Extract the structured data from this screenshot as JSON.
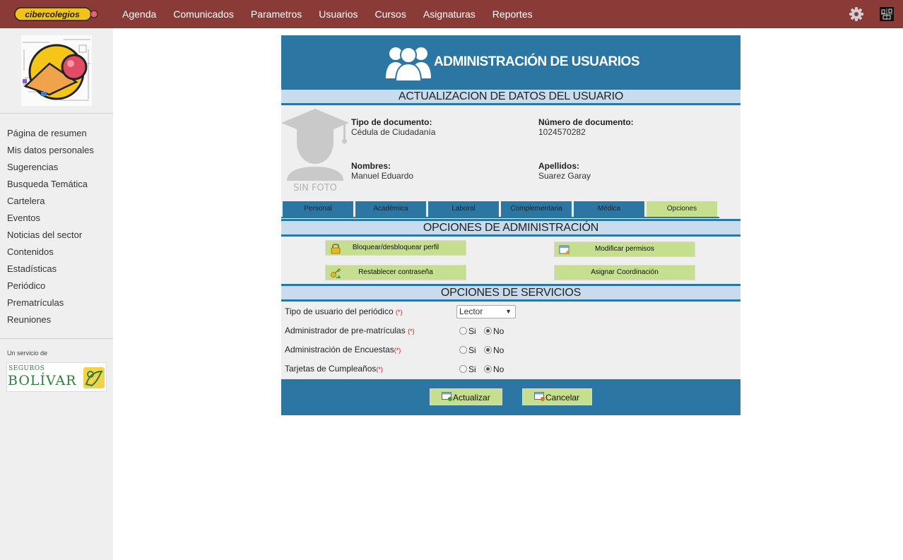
{
  "app": {
    "logo_text": "cibercolegios",
    "nav": [
      "Agenda",
      "Comunicados",
      "Parametros",
      "Usuarios",
      "Cursos",
      "Asignaturas",
      "Reportes"
    ]
  },
  "sidebar": {
    "items": [
      "Página de resumen",
      "Mis datos personales",
      "Sugerencias",
      "Busqueda Temática",
      "Cartelera",
      "Eventos",
      "Noticias del sector",
      "Contenidos",
      "Estadísticas",
      "Periódico",
      "Prematrículas",
      "Reuniones"
    ],
    "service_label": "Un servicio de",
    "sponsor_top": "SEGUROS",
    "sponsor_name": "BOLÍVAR"
  },
  "panel": {
    "title": "ADMINISTRACIÓN DE USUARIOS",
    "section_update": "ACTUALIZACION DE DATOS DEL USUARIO",
    "photo_caption": "SIN FOTO",
    "user": {
      "doc_type_label": "Tipo de documento:",
      "doc_type_value": "Cédula de Ciudadanía",
      "doc_number_label": "Número de documento:",
      "doc_number_value": "1024570282",
      "names_label": "Nombres:",
      "names_value": "Manuel Eduardo",
      "surnames_label": "Apellidos:",
      "surnames_value": "Suarez Garay"
    },
    "tabs": [
      "Personal",
      "Académica",
      "Laboral",
      "Complementaria",
      "Médica",
      "Opciones"
    ],
    "active_tab": "Opciones",
    "section_admin": "OPCIONES DE ADMINISTRACIÓN",
    "admin_buttons": {
      "lock": "Bloquear/desbloquear perfil",
      "permissions": "Modificar permisos",
      "reset_password": "Restablecer contraseña",
      "coordination": "Asignar Coordinación"
    },
    "section_services": "OPCIONES DE SERVICIOS",
    "services": {
      "newspaper_label": "Tipo de usuario del periódico",
      "newspaper_value": "Lector",
      "prematricula_label": "Administrador de pre-matrículas",
      "surveys_label": "Administración de Encuestas",
      "birthday_label": "Tarjetas de Cumpleaños",
      "required_mark": "(*)",
      "yes": "Si",
      "no": "No"
    },
    "footer": {
      "update": "Actualizar",
      "cancel": "Cancelar"
    }
  },
  "colors": {
    "topbar": "#8a3b37",
    "header_blue": "#2c76a3",
    "button_green": "#c5df8f",
    "section_light": "#c8dcee"
  }
}
